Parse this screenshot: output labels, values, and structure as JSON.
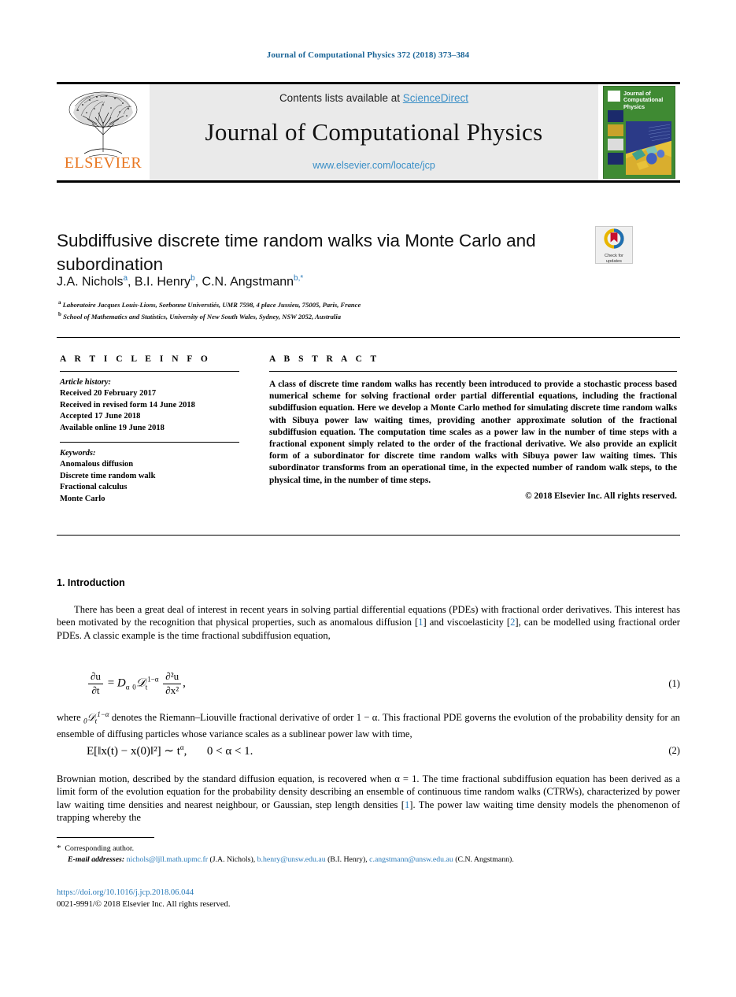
{
  "running_head": "Journal of Computational Physics 372 (2018) 373–384",
  "masthead": {
    "publisher_name": "ELSEVIER",
    "publisher_logo_icon": "elsevier-tree-icon",
    "contents_prefix": "Contents lists available at ",
    "contents_link": "ScienceDirect",
    "journal_title": "Journal of Computational Physics",
    "journal_url": "www.elsevier.com/locate/jcp",
    "cover_title": "Journal of Computational Physics",
    "cover_color": "#3f8a33"
  },
  "article": {
    "title": "Subdiffusive discrete time random walks via Monte Carlo and subordination",
    "crossmark": {
      "icon": "crossmark-icon",
      "line1": "Check for",
      "line2": "updates"
    },
    "authors": [
      {
        "name": "J.A. Nichols",
        "marks": "a",
        "sep": ", "
      },
      {
        "name": "B.I. Henry",
        "marks": "b",
        "sep": ", "
      },
      {
        "name": "C.N. Angstmann",
        "marks": "b,",
        "star": "*",
        "sep": ""
      }
    ],
    "affiliations": [
      {
        "mark": "a",
        "text": "Laboratoire Jacques Louis-Lions, Sorbonne Universtiés, UMR 7598, 4 place Jussieu, 75005, Paris, France"
      },
      {
        "mark": "b",
        "text": "School of Mathematics and Statistics, University of New South Wales, Sydney, NSW 2052, Australia"
      }
    ]
  },
  "article_info": {
    "heading": "A R T I C L E    I N F O",
    "history_label": "Article history:",
    "history": [
      "Received 20 February 2017",
      "Received in revised form 14 June 2018",
      "Accepted 17 June 2018",
      "Available online 19 June 2018"
    ],
    "keywords_label": "Keywords:",
    "keywords": [
      "Anomalous diffusion",
      "Discrete time random walk",
      "Fractional calculus",
      "Monte Carlo"
    ]
  },
  "abstract": {
    "heading": "A B S T R A C T",
    "body": "A class of discrete time random walks has recently been introduced to provide a stochastic process based numerical scheme for solving fractional order partial differential equations, including the fractional subdiffusion equation. Here we develop a Monte Carlo method for simulating discrete time random walks with Sibuya power law waiting times, providing another approximate solution of the fractional subdiffusion equation. The computation time scales as a power law in the number of time steps with a fractional exponent simply related to the order of the fractional derivative. We also provide an explicit form of a subordinator for discrete time random walks with Sibuya power law waiting times. This subordinator transforms from an operational time, in the expected number of random walk steps, to the physical time, in the number of time steps.",
    "copyright": "© 2018 Elsevier Inc. All rights reserved."
  },
  "body": {
    "section_number": "1.",
    "section_title": "Introduction",
    "paragraph1_parts": {
      "a": "There has been a great deal of interest in recent years in solving partial differential equations (PDEs) with fractional order derivatives. This interest has been motivated by the recognition that physical properties, such as anomalous diffusion [",
      "cite1": "1",
      "b": "] and viscoelasticity [",
      "cite2": "2",
      "c": "], can be modelled using fractional order PDEs. A classic example is the time fractional subdiffusion equation,"
    },
    "equation1_number": "(1)",
    "paragraph2": "where ₀𝒟ₜ^{1−α} denotes the Riemann–Liouville fractional derivative of order 1 − α. This fractional PDE governs the evolution of the probability density for an ensemble of diffusing particles whose variance scales as a sublinear power law with time,",
    "paragraph2_parts": {
      "a": "where ",
      "sym": "0D_t^{1-a}",
      "b": " denotes the Riemann–Liouville fractional derivative of order 1 − α. This fractional PDE governs the evolution of the probability density for an ensemble of diffusing particles whose variance scales as a sublinear power law with time,"
    },
    "equation2_number": "(2)",
    "paragraph3_parts": {
      "a": "Brownian motion, described by the standard diffusion equation, is recovered when α = 1. The time fractional subdiffusion equation has been derived as a limit form of the evolution equation for the probability density describing an ensemble of continuous time random walks (CTRWs), characterized by power law waiting time densities and nearest neighbour, or Gaussian, step length densities [",
      "cite1": "1",
      "b": "]. The power law waiting time density models the phenomenon of trapping whereby the"
    }
  },
  "math": {
    "eq1": {
      "lhs_num": "∂u",
      "lhs_den": "∂t",
      "equals": "=",
      "coef": "D",
      "coef_sub": "α",
      "op_presub": "0",
      "op": "𝒟",
      "op_sub": "t",
      "op_sup": "1−α",
      "rhs_num": "∂²u",
      "rhs_den": "∂x²",
      "comma": ","
    },
    "eq2": {
      "expr": "E[‖x(t) − x(0)‖²] ∼ t",
      "exp": "α",
      "comma": ",",
      "range": "0 < α < 1."
    }
  },
  "footnotes": {
    "star": "*",
    "corresponding": "Corresponding author.",
    "email_label": "E-mail addresses:",
    "emails": [
      {
        "address": "nichols@ljll.math.upmc.fr",
        "owner": "(J.A. Nichols), "
      },
      {
        "address": "b.henry@unsw.edu.au",
        "owner": "(B.I. Henry), "
      },
      {
        "address": "c.angstmann@unsw.edu.au",
        "owner": "(C.N. Angstmann)."
      }
    ],
    "doi": "https://doi.org/10.1016/j.jcp.2018.06.044",
    "issn_line": "0021-9991/© 2018 Elsevier Inc. All rights reserved."
  },
  "colors": {
    "link": "#2b7bb9",
    "elsevier_orange": "#e87722",
    "cover_green": "#3f8a33",
    "masthead_grey": "#eaeaea"
  }
}
